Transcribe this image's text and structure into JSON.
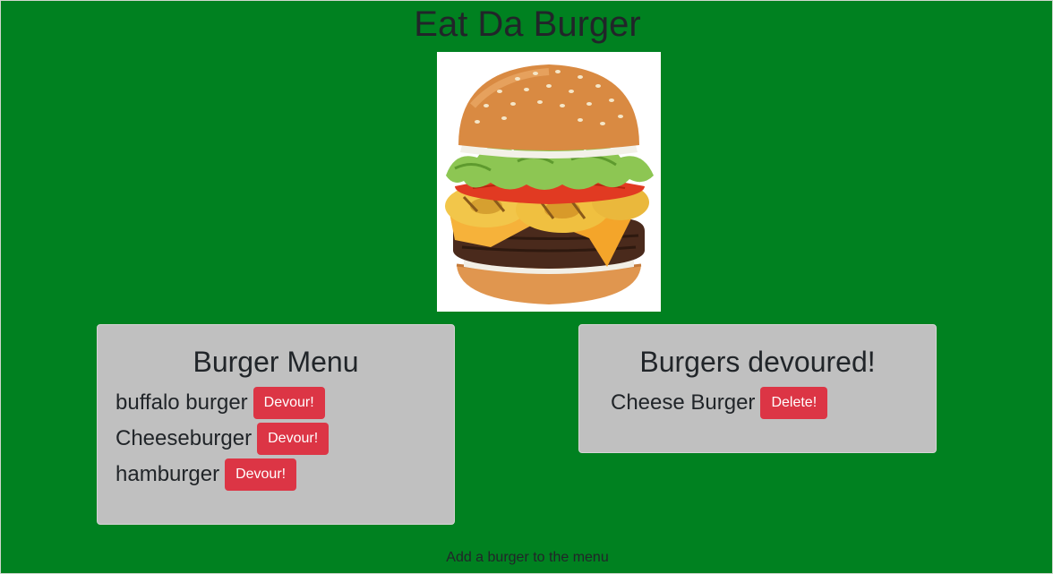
{
  "header": {
    "title": "Eat Da Burger"
  },
  "hero": {
    "image": "burger-image"
  },
  "menu": {
    "heading": "Burger Menu",
    "items": [
      {
        "name": "buffalo burger",
        "action": "Devour!"
      },
      {
        "name": "Cheeseburger",
        "action": "Devour!"
      },
      {
        "name": "hamburger",
        "action": "Devour!"
      }
    ]
  },
  "devoured": {
    "heading": "Burgers devoured!",
    "items": [
      {
        "name": "Cheese Burger",
        "action": "Delete!"
      }
    ]
  },
  "footer": {
    "add_label": "Add a burger to the menu"
  },
  "colors": {
    "background": "#008120",
    "card": "#c0c0c0",
    "button": "#dc3545",
    "text": "#212529"
  }
}
